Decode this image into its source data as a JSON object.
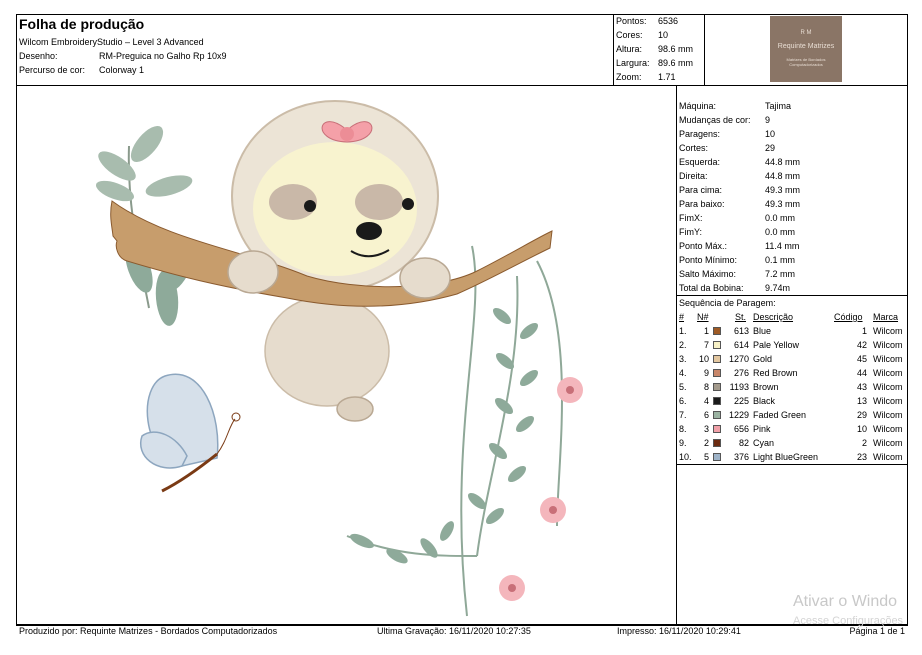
{
  "header": {
    "title": "Folha de produção",
    "software": "Wilcom EmbroideryStudio – Level 3 Advanced",
    "design_label": "Desenho:",
    "design_value": "RM-Preguica no Galho Rp 10x9",
    "colorway_label": "Percurso de cor:",
    "colorway_value": "Colorway 1"
  },
  "stats": [
    {
      "label": "Pontos:",
      "value": "6536"
    },
    {
      "label": "Cores:",
      "value": "10"
    },
    {
      "label": "Altura:",
      "value": "98.6 mm"
    },
    {
      "label": "Largura:",
      "value": "89.6 mm"
    },
    {
      "label": "Zoom:",
      "value": "1.71"
    }
  ],
  "logo": {
    "line1": "R M",
    "line2": "Requinte Matrizes",
    "line3": "Matrizes de Bordados Computadorizados"
  },
  "machine_info": [
    {
      "label": "Máquina:",
      "value": "Tajima"
    },
    {
      "label": "Mudanças de cor:",
      "value": "9"
    },
    {
      "label": "Paragens:",
      "value": "10"
    },
    {
      "label": "Cortes:",
      "value": "29"
    },
    {
      "label": "Esquerda:",
      "value": "44.8 mm"
    },
    {
      "label": "Direita:",
      "value": "44.8 mm"
    },
    {
      "label": "Para cima:",
      "value": "49.3 mm"
    },
    {
      "label": "Para baixo:",
      "value": "49.3 mm"
    },
    {
      "label": "FimX:",
      "value": "0.0 mm"
    },
    {
      "label": "FimY:",
      "value": "0.0 mm"
    },
    {
      "label": "Ponto Máx.:",
      "value": "11.4 mm"
    },
    {
      "label": "Ponto Mínimo:",
      "value": "0.1 mm"
    },
    {
      "label": "Salto Máximo:",
      "value": "7.2 mm"
    },
    {
      "label": "Total da Bobina:",
      "value": "9.74m"
    }
  ],
  "sequence": {
    "title": "Sequência de Paragem:",
    "headers": {
      "num": "#",
      "n": "N#",
      "st": "St.",
      "desc": "Descrição",
      "code": "Código",
      "brand": "Marca"
    },
    "rows": [
      {
        "num": "1.",
        "n": "1",
        "color": "#9e5a24",
        "st": "613",
        "desc": "Blue",
        "code": "1",
        "brand": "Wilcom"
      },
      {
        "num": "2.",
        "n": "7",
        "color": "#f7f1c6",
        "st": "614",
        "desc": "Pale Yellow",
        "code": "42",
        "brand": "Wilcom"
      },
      {
        "num": "3.",
        "n": "10",
        "color": "#e3c7a0",
        "st": "1270",
        "desc": "Gold",
        "code": "45",
        "brand": "Wilcom"
      },
      {
        "num": "4.",
        "n": "9",
        "color": "#c9876a",
        "st": "276",
        "desc": "Red Brown",
        "code": "44",
        "brand": "Wilcom"
      },
      {
        "num": "5.",
        "n": "8",
        "color": "#a39a8c",
        "st": "1193",
        "desc": "Brown",
        "code": "43",
        "brand": "Wilcom"
      },
      {
        "num": "6.",
        "n": "4",
        "color": "#1a1a1a",
        "st": "225",
        "desc": "Black",
        "code": "13",
        "brand": "Wilcom"
      },
      {
        "num": "7.",
        "n": "6",
        "color": "#9bb3a2",
        "st": "1229",
        "desc": "Faded Green",
        "code": "29",
        "brand": "Wilcom"
      },
      {
        "num": "8.",
        "n": "3",
        "color": "#f0a0a8",
        "st": "656",
        "desc": "Pink",
        "code": "10",
        "brand": "Wilcom"
      },
      {
        "num": "9.",
        "n": "2",
        "color": "#6b2a10",
        "st": "82",
        "desc": "Cyan",
        "code": "2",
        "brand": "Wilcom"
      },
      {
        "num": "10.",
        "n": "5",
        "color": "#9eb3c8",
        "st": "376",
        "desc": "Light BlueGreen",
        "code": "23",
        "brand": "Wilcom"
      }
    ]
  },
  "footer": {
    "producer": "Produzido por: Requinte Matrizes - Bordados Computadorizados",
    "last_saved": "Ultima Gravação: 16/11/2020 10:27:35",
    "printed": "Impresso: 16/11/2020 10:29:41",
    "page": "Página 1 de 1"
  },
  "watermark": {
    "line1": "Ativar o Windo",
    "line2": "Acesse Configurações"
  }
}
